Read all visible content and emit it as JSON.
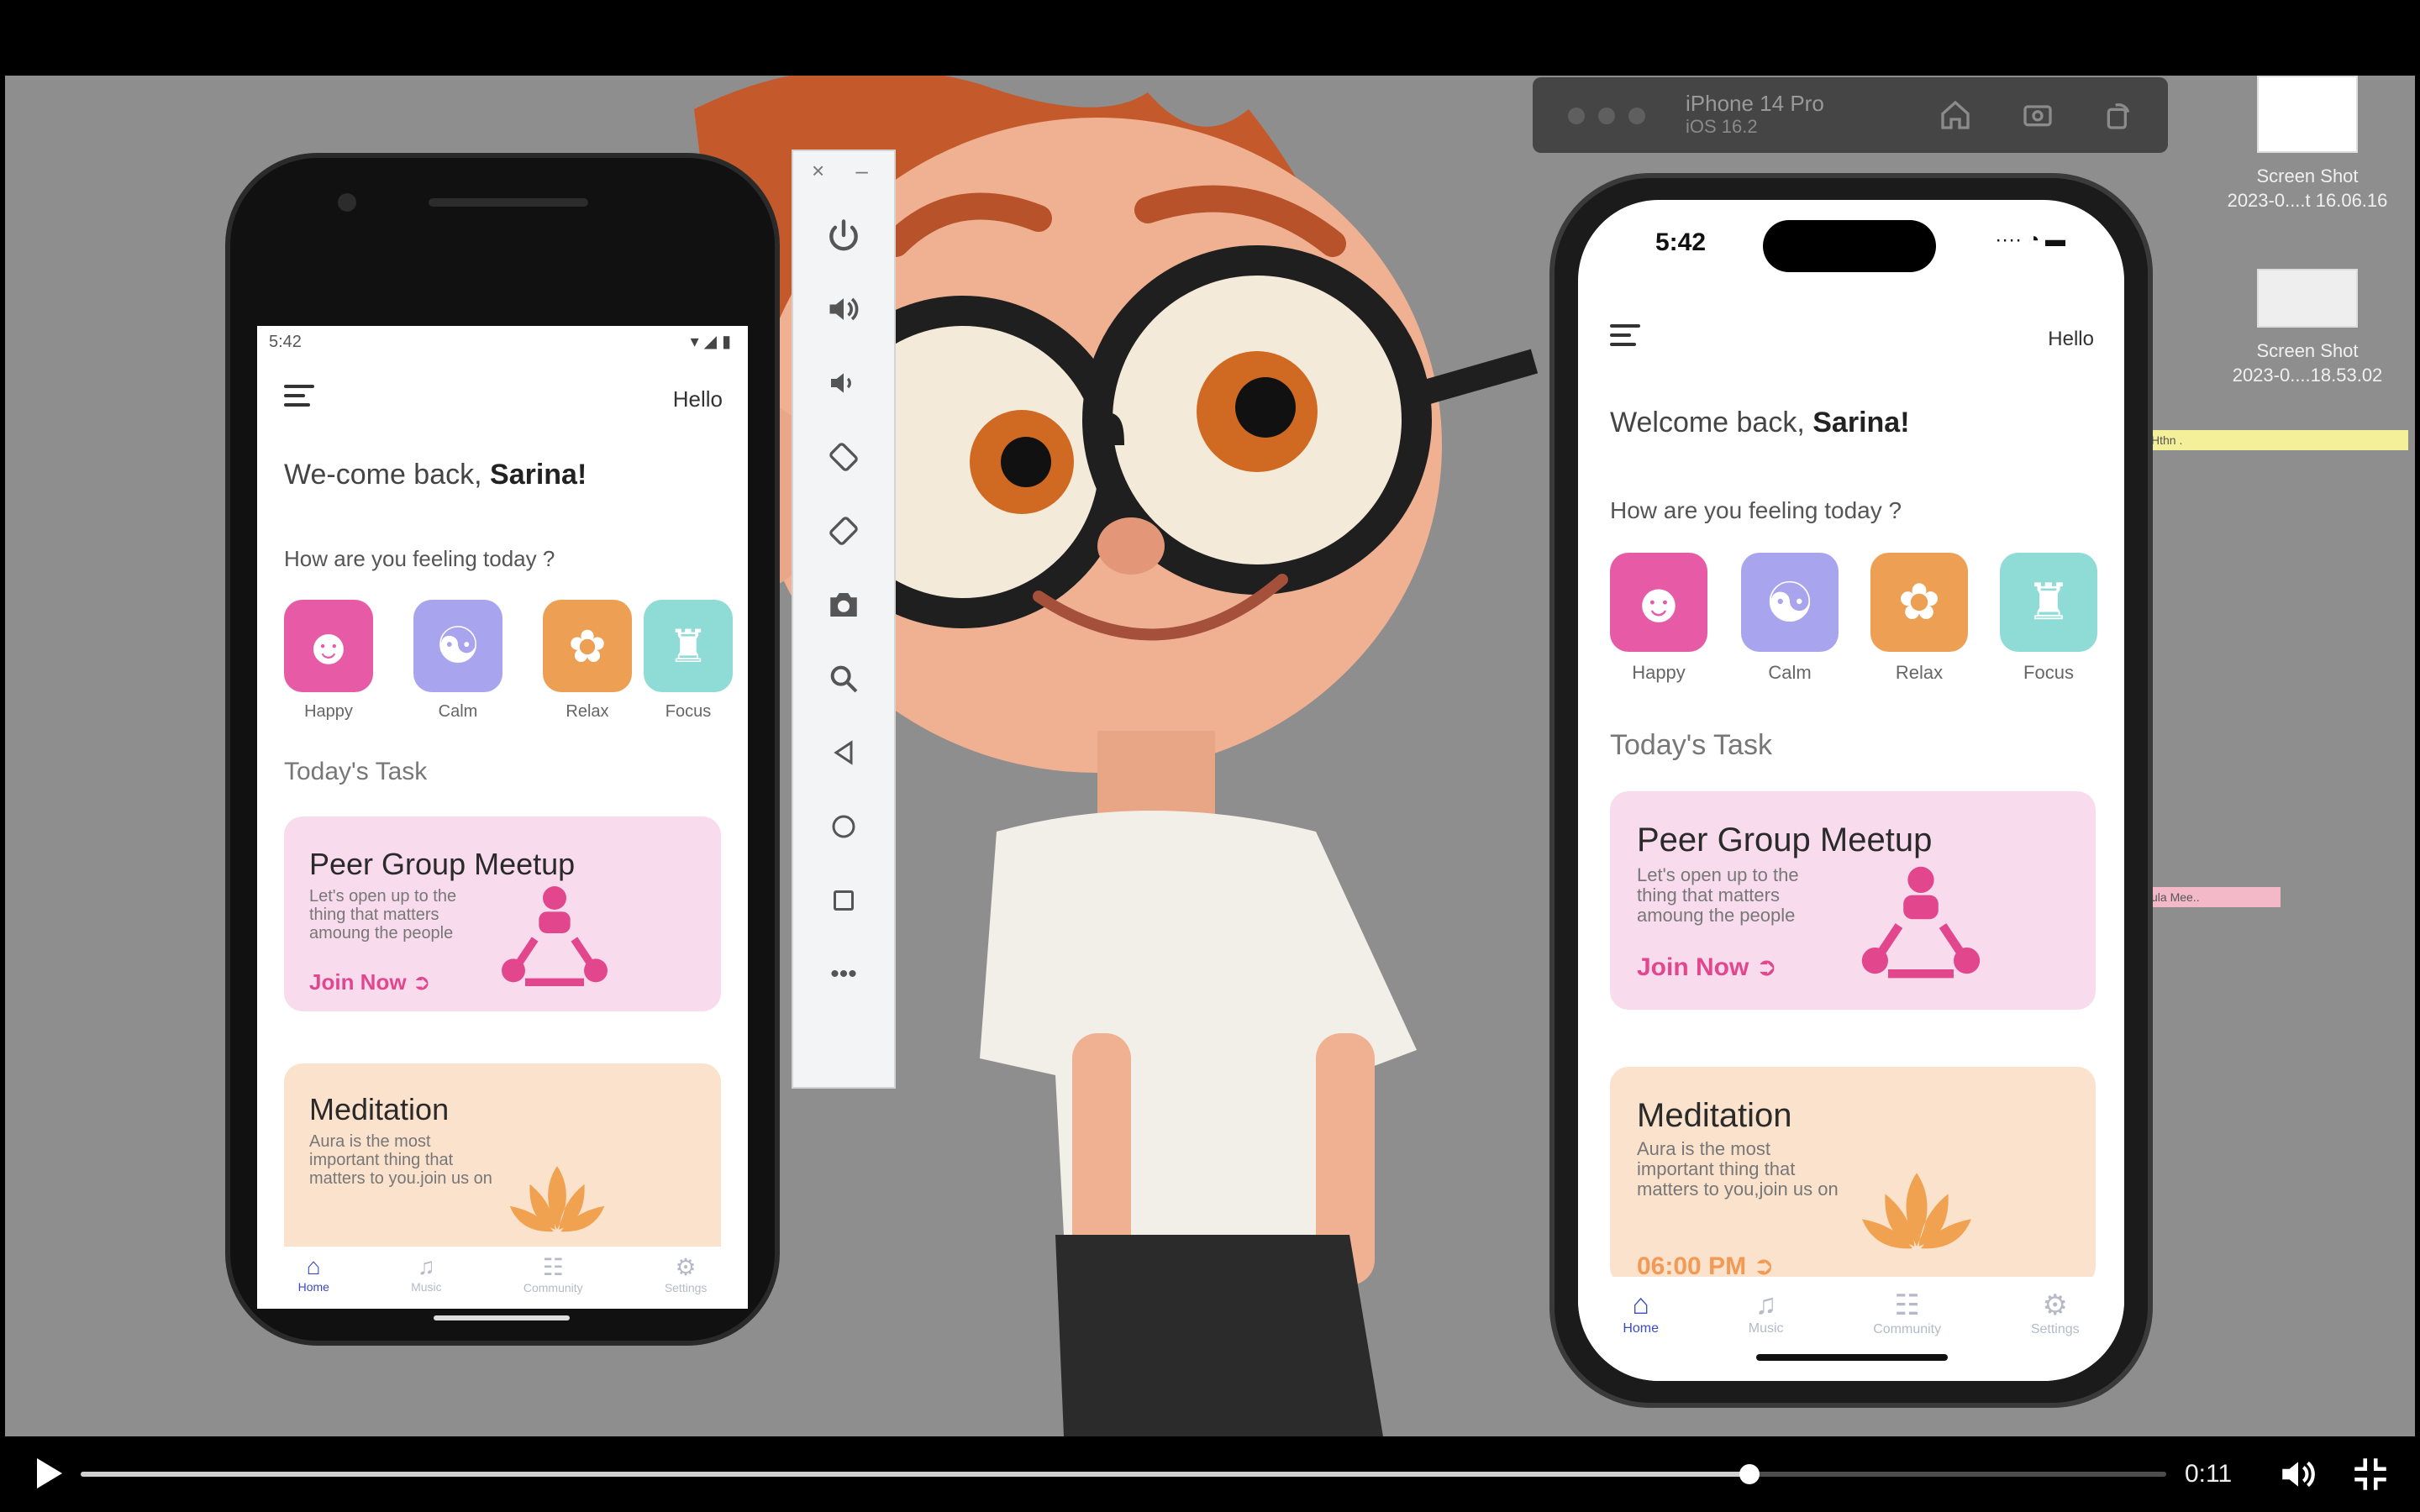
{
  "player": {
    "time": "0:11",
    "progress_fraction": 0.8
  },
  "desktop": {
    "files": [
      {
        "line1": "Screen Shot",
        "line2": "2023-0....t 16.06.16"
      },
      {
        "line1": "Screen Shot",
        "line2": "2023-0....18.53.02"
      }
    ],
    "sticky_notes": [
      "Hthn .",
      "ula Mee.."
    ]
  },
  "simulator": {
    "device_name": "iPhone 14 Pro",
    "os_version": "iOS 16.2"
  },
  "colors": {
    "happy": "#e65aa6",
    "calm": "#a9a4ee",
    "relax": "#eda053",
    "focus": "#8fdcd7",
    "peer_card": "#f8dcee",
    "meditation_card": "#fbe2cc",
    "join_accent": "#e2478e",
    "time_accent": "#f29a55",
    "tab_active": "#3b4cc0"
  },
  "android": {
    "status_time": "5:42",
    "hello": "Hello",
    "welcome_prefix": "We-come back, ",
    "user_name": "Sarina!",
    "feeling_prompt": "How are you feeling today ?",
    "moods": [
      {
        "label": "Happy",
        "icon": "smiley-icon"
      },
      {
        "label": "Calm",
        "icon": "yin-yang-icon"
      },
      {
        "label": "Relax",
        "icon": "triskelion-icon"
      },
      {
        "label": "Focus",
        "icon": "focus-figure-icon"
      }
    ],
    "tasks_title": "Today's Task",
    "cards": [
      {
        "title": "Peer Group Meetup",
        "desc": "Let's open up to the thing that matters amoung the people",
        "action": "Join Now"
      },
      {
        "title": "Meditation",
        "desc": "Aura is the most important thing that matters to you.join us on",
        "action": ""
      }
    ],
    "tabs": [
      "Home",
      "Music",
      "Community",
      "Settings"
    ]
  },
  "ios": {
    "status_time": "5:42",
    "hello": "Hello",
    "welcome_prefix": "Welcome back, ",
    "user_name": "Sarina!",
    "feeling_prompt": "How are you feeling today ?",
    "moods": [
      {
        "label": "Happy",
        "icon": "smiley-icon"
      },
      {
        "label": "Calm",
        "icon": "yin-yang-icon"
      },
      {
        "label": "Relax",
        "icon": "triskelion-icon"
      },
      {
        "label": "Focus",
        "icon": "focus-figure-icon"
      }
    ],
    "tasks_title": "Today's Task",
    "cards": [
      {
        "title": "Peer Group Meetup",
        "desc": "Let's open up to the thing that matters amoung the people",
        "action": "Join Now"
      },
      {
        "title": "Meditation",
        "desc": "Aura is the most important thing that matters to you,join us on",
        "action": "06:00 PM"
      }
    ],
    "tabs": [
      "Home",
      "Music",
      "Community",
      "Settings"
    ]
  }
}
